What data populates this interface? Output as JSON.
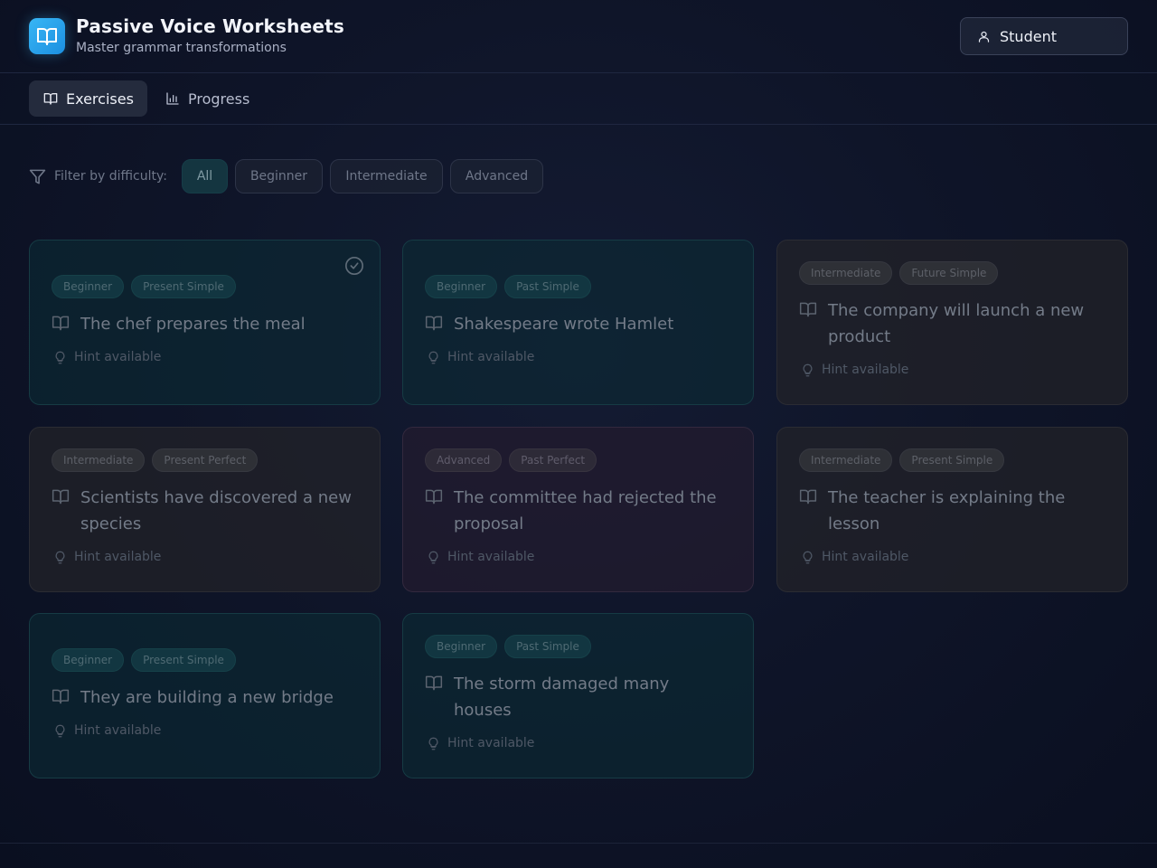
{
  "header": {
    "title": "Passive Voice Worksheets",
    "subtitle": "Master grammar transformations",
    "logo_icon": "book-open-icon",
    "user_label": "Student"
  },
  "nav": {
    "tabs": [
      {
        "label": "Exercises",
        "icon": "book-open-icon",
        "active": true
      },
      {
        "label": "Progress",
        "icon": "bar-chart-icon",
        "active": false
      }
    ]
  },
  "filter": {
    "label": "Filter by difficulty:",
    "options": [
      "All",
      "Beginner",
      "Intermediate",
      "Advanced"
    ],
    "selected": "All"
  },
  "exercises": [
    {
      "difficulty": "Beginner",
      "tense": "Present Simple",
      "sentence": "The chef prepares the meal",
      "hint": "Hint available",
      "completed": true
    },
    {
      "difficulty": "Beginner",
      "tense": "Past Simple",
      "sentence": "Shakespeare wrote Hamlet",
      "hint": "Hint available",
      "completed": false
    },
    {
      "difficulty": "Intermediate",
      "tense": "Future Simple",
      "sentence": "The company will launch a new product",
      "hint": "Hint available",
      "completed": false
    },
    {
      "difficulty": "Intermediate",
      "tense": "Present Perfect",
      "sentence": "Scientists have discovered a new species",
      "hint": "Hint available",
      "completed": false
    },
    {
      "difficulty": "Advanced",
      "tense": "Past Perfect",
      "sentence": "The committee had rejected the proposal",
      "hint": "Hint available",
      "completed": false
    },
    {
      "difficulty": "Intermediate",
      "tense": "Present Simple",
      "sentence": "The teacher is explaining the lesson",
      "hint": "Hint available",
      "completed": false
    },
    {
      "difficulty": "Beginner",
      "tense": "Present Simple",
      "sentence": "They are building a new bridge",
      "hint": "Hint available",
      "completed": false
    },
    {
      "difficulty": "Beginner",
      "tense": "Past Simple",
      "sentence": "The storm damaged many houses",
      "hint": "Hint available",
      "completed": false
    }
  ],
  "colors": {
    "accent": "#38b6f5",
    "beginner_card": "#0c2a34",
    "intermediate_card": "#222328",
    "advanced_card": "#211b2e"
  }
}
